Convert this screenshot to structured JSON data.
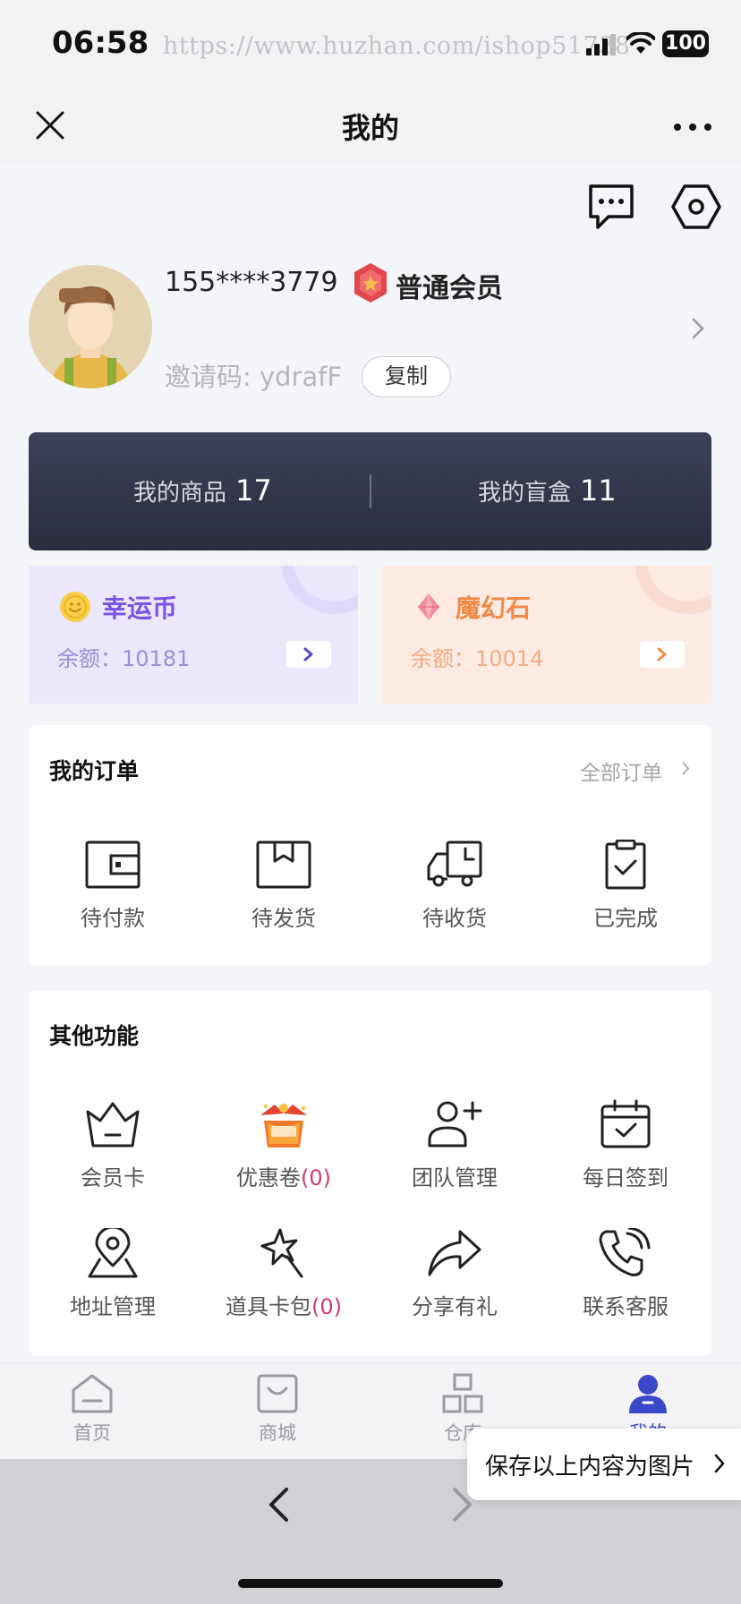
{
  "status_bar": {
    "time": "06:58",
    "watermark": "https://www.huzhan.com/ishop51738",
    "battery": "100"
  },
  "nav": {
    "title": "我的",
    "close_icon": "close-icon",
    "more_icon": "more-dots-icon"
  },
  "header_icons": {
    "message": "chat-bubble-icon",
    "settings": "hexagon-settings-icon"
  },
  "profile": {
    "phone": "155****3779",
    "member_level": "普通会员",
    "invite_code": "邀请码: ydrafF",
    "copy_label": "复制"
  },
  "stats": {
    "goods_label": "我的商品",
    "goods_count": "17",
    "blindbox_label": "我的盲盒",
    "blindbox_count": "11"
  },
  "wallets": {
    "coin": {
      "name": "幸运币",
      "balance": "余额：10181",
      "icon": "smiley-coin-icon"
    },
    "stone": {
      "name": "魔幻石",
      "balance": "余额：10014",
      "icon": "gem-icon"
    }
  },
  "orders": {
    "title": "我的订单",
    "all_label": "全部订单",
    "items": [
      {
        "label": "待付款",
        "icon": "wallet-icon"
      },
      {
        "label": "待发货",
        "icon": "package-icon"
      },
      {
        "label": "待收货",
        "icon": "truck-icon"
      },
      {
        "label": "已完成",
        "icon": "clipboard-check-icon"
      }
    ]
  },
  "features": {
    "title": "其他功能",
    "items": [
      {
        "label": "会员卡",
        "icon": "crown-icon"
      },
      {
        "label": "优惠卷",
        "count": "(0)",
        "icon": "gift-box-icon"
      },
      {
        "label": "团队管理",
        "icon": "user-add-icon"
      },
      {
        "label": "每日签到",
        "icon": "calendar-check-icon"
      },
      {
        "label": "地址管理",
        "icon": "location-pin-icon"
      },
      {
        "label": "道具卡包",
        "count": "(0)",
        "icon": "magic-wand-icon"
      },
      {
        "label": "分享有礼",
        "icon": "share-arrow-icon"
      },
      {
        "label": "联系客服",
        "icon": "phone-icon"
      }
    ]
  },
  "tabbar": {
    "items": [
      {
        "label": "首页",
        "icon": "home-icon"
      },
      {
        "label": "商城",
        "icon": "shop-bag-icon"
      },
      {
        "label": "仓库",
        "icon": "warehouse-icon"
      },
      {
        "label": "我的",
        "icon": "user-icon",
        "active": true
      }
    ]
  },
  "popup": {
    "save_label": "保存以上内容为图片"
  },
  "colors": {
    "accent": "#3b47c9",
    "coin": "#7b52e3",
    "stone": "#f08a45",
    "count_red": "#d23a6e",
    "stats_bg": "#2f3246"
  }
}
